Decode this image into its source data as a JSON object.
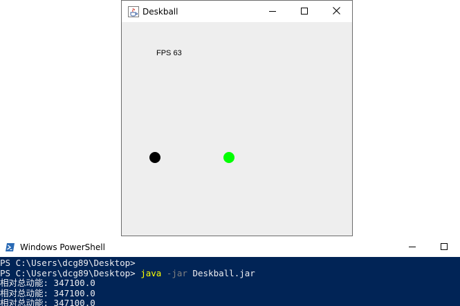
{
  "app_window": {
    "title": "Deskball",
    "fps_label": "FPS 63",
    "balls": [
      {
        "name": "black-ball",
        "color": "#000000"
      },
      {
        "name": "green-ball",
        "color": "#00ff00"
      }
    ],
    "colors": {
      "titlebar": "#ffffff",
      "canvas": "#eeeeee"
    }
  },
  "powershell": {
    "title": "Windows PowerShell",
    "prompt_1": "PS C:\\Users\\dcg89\\Desktop>",
    "prompt_2": "PS C:\\Users\\dcg89\\Desktop> ",
    "command": {
      "cmd": "java",
      "param": "-jar",
      "arg": "Deskball.jar"
    },
    "output_lines": [
      "相对总动能: 347100.0",
      "相对总动能: 347100.0",
      "相对总动能: 347100.0"
    ],
    "colors": {
      "background": "#012456",
      "text": "#eeedf0",
      "command": "#ffff00",
      "parameter": "#808080"
    }
  },
  "icons": [
    "java-cup-icon",
    "minimize-icon",
    "maximize-icon",
    "close-icon",
    "powershell-icon"
  ]
}
